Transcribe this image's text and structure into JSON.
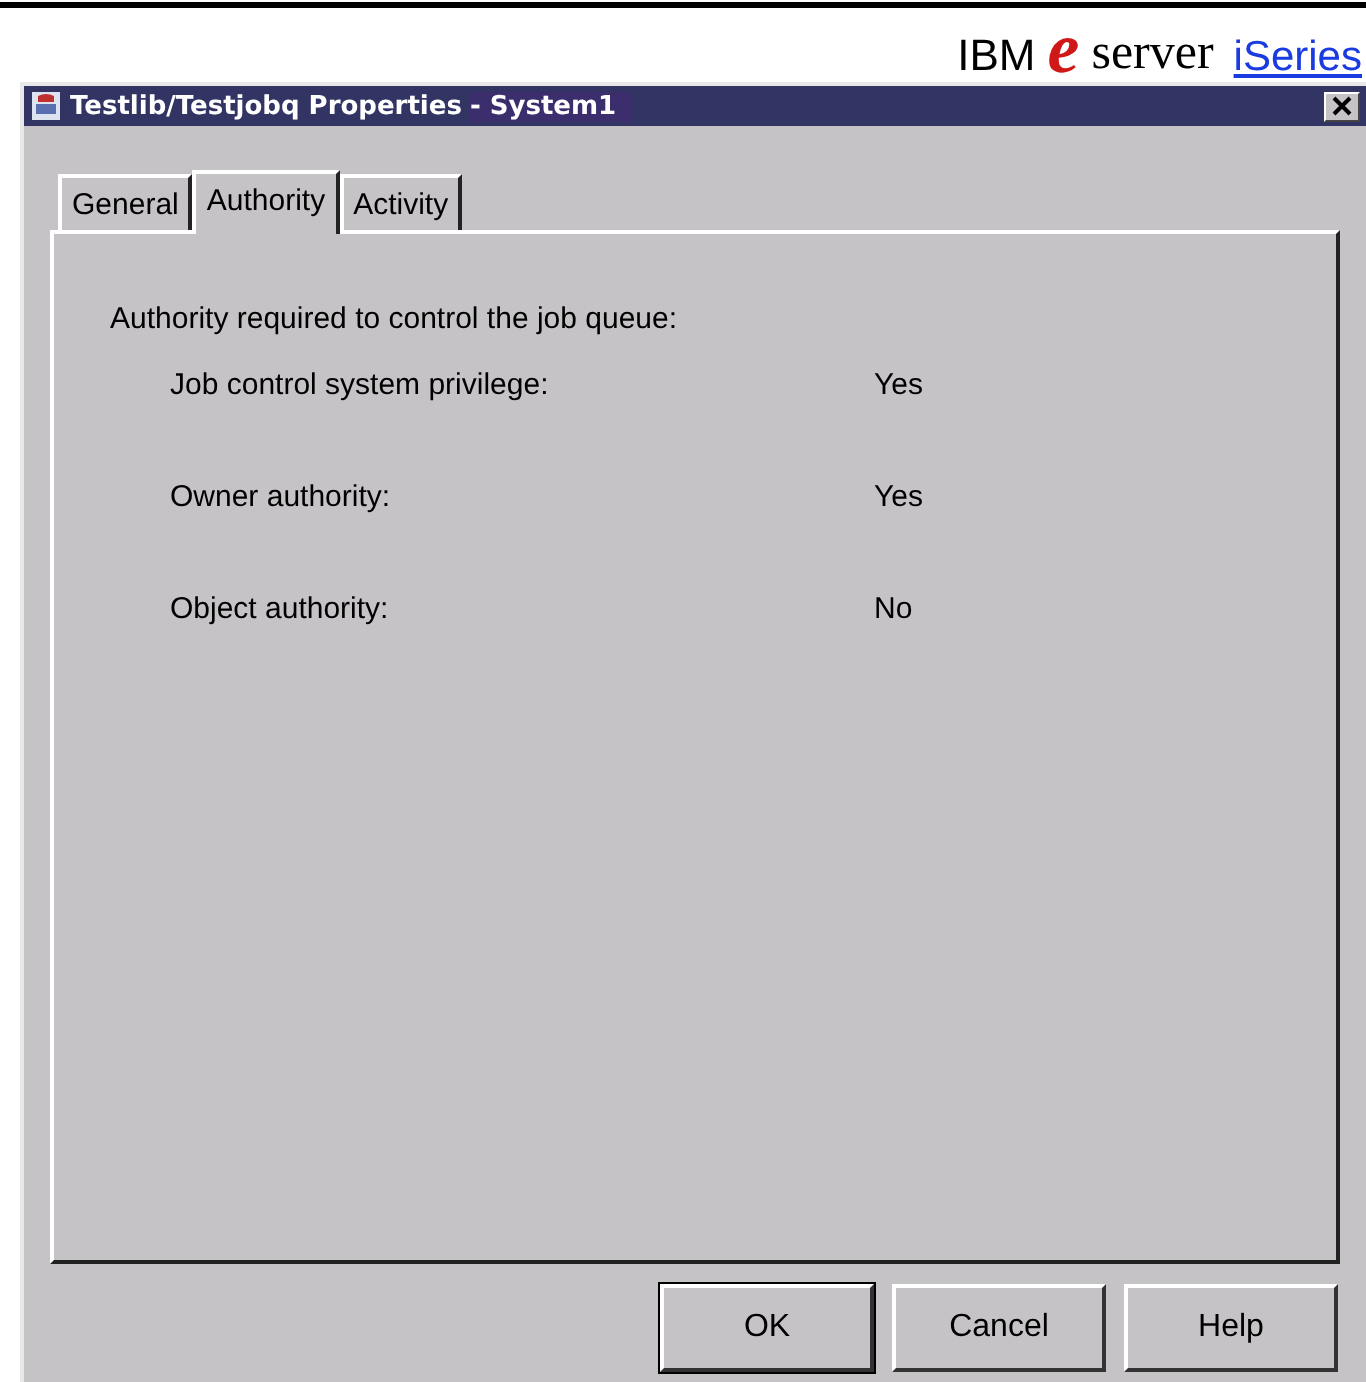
{
  "brand": {
    "company": "IBM",
    "mark": "e",
    "product": "server",
    "line": "iSeries"
  },
  "window": {
    "title": "Testlib/Testjobq Properties",
    "system": "- System1"
  },
  "tabs": [
    {
      "label": "General",
      "selected": false
    },
    {
      "label": "Authority",
      "selected": true
    },
    {
      "label": "Activity",
      "selected": false
    }
  ],
  "panel": {
    "heading": "Authority required to control the job queue:",
    "rows": [
      {
        "label": "Job control system privilege:",
        "value": "Yes"
      },
      {
        "label": "Owner authority:",
        "value": "Yes"
      },
      {
        "label": "Object authority:",
        "value": "No"
      }
    ]
  },
  "buttons": [
    {
      "label": "OK",
      "default": true
    },
    {
      "label": "Cancel",
      "default": false
    },
    {
      "label": "Help",
      "default": false
    }
  ]
}
